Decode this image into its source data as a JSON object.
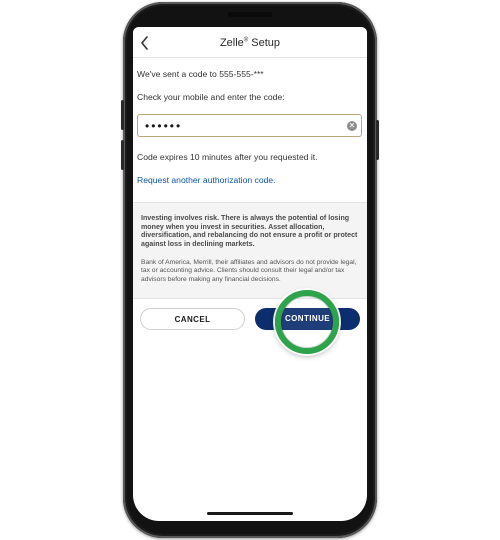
{
  "header": {
    "title_prefix": "Zelle",
    "title_mark": "®",
    "title_suffix": " Setup"
  },
  "content": {
    "sent_message": "We've sent a code to 555-555-***",
    "instruction": "Check your mobile and enter the code:",
    "code_value": "••••••",
    "expiry_note": "Code expires 10 minutes after you requested it.",
    "request_link": "Request another authorization code."
  },
  "disclaimer": {
    "paragraph1": "Investing involves risk. There is always the potential of losing money when you invest in securities. Asset allocation, diversification, and rebalancing do not ensure a profit or protect against loss in declining markets.",
    "paragraph2": "Bank of America, Merrill, their affiliates and advisors do not provide legal, tax or accounting advice. Clients should consult their legal and/or tax advisors before making any financial decisions."
  },
  "buttons": {
    "cancel": "CANCEL",
    "continue": "CONTINUE"
  },
  "colors": {
    "primary_button": "#0c2e6e",
    "link": "#0d55a8",
    "input_border": "#b8a77a",
    "highlight_ring": "#2ea34b"
  },
  "icons": {
    "back": "chevron-left-icon",
    "clear": "clear-circle-icon"
  }
}
